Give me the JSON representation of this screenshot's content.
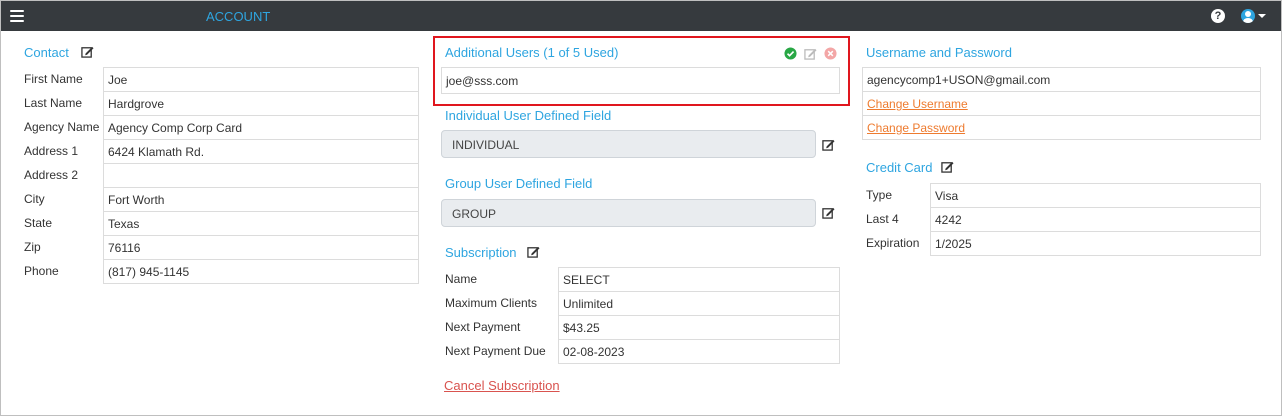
{
  "topbar": {
    "menu_icon": "hamburger-icon",
    "title": "ACCOUNT",
    "help_icon": "question-circle-icon",
    "user_icon": "user-circle-icon"
  },
  "contact": {
    "heading": "Contact",
    "fields": [
      {
        "label": "First Name",
        "value": "Joe"
      },
      {
        "label": "Last Name",
        "value": "Hardgrove"
      },
      {
        "label": "Agency Name",
        "value": "Agency Comp Corp Card"
      },
      {
        "label": "Address 1",
        "value": "6424 Klamath Rd."
      },
      {
        "label": "Address 2",
        "value": ""
      },
      {
        "label": "City",
        "value": "Fort Worth"
      },
      {
        "label": "State",
        "value": "Texas"
      },
      {
        "label": "Zip",
        "value": "76116"
      },
      {
        "label": "Phone",
        "value": "(817) 945-1145"
      }
    ]
  },
  "additional_users": {
    "heading": "Additional Users (1 of 5 Used)",
    "email": "joe@sss.com"
  },
  "individual_field": {
    "heading": "Individual User Defined Field",
    "value": "INDIVIDUAL"
  },
  "group_field": {
    "heading": "Group User Defined Field",
    "value": "GROUP"
  },
  "subscription": {
    "heading": "Subscription",
    "fields": [
      {
        "label": "Name",
        "value": "SELECT"
      },
      {
        "label": "Maximum Clients",
        "value": "Unlimited"
      },
      {
        "label": "Next Payment",
        "value": "$43.25"
      },
      {
        "label": "Next Payment Due",
        "value": "02-08-2023"
      }
    ],
    "cancel_label": "Cancel Subscription"
  },
  "credentials": {
    "heading": "Username and Password",
    "username": "agencycomp1+USON@gmail.com",
    "change_username": "Change Username",
    "change_password": "Change Password"
  },
  "credit_card": {
    "heading": "Credit Card",
    "fields": [
      {
        "label": "Type",
        "value": "Visa"
      },
      {
        "label": "Last 4",
        "value": "4242"
      },
      {
        "label": "Expiration",
        "value": "1/2025"
      }
    ]
  },
  "colors": {
    "topbar_bg": "#363a3e",
    "accent": "#2ea5e0",
    "link": "#ee7b2f",
    "danger": "#d9534f",
    "highlight": "#e0161e",
    "success": "#28a745"
  }
}
